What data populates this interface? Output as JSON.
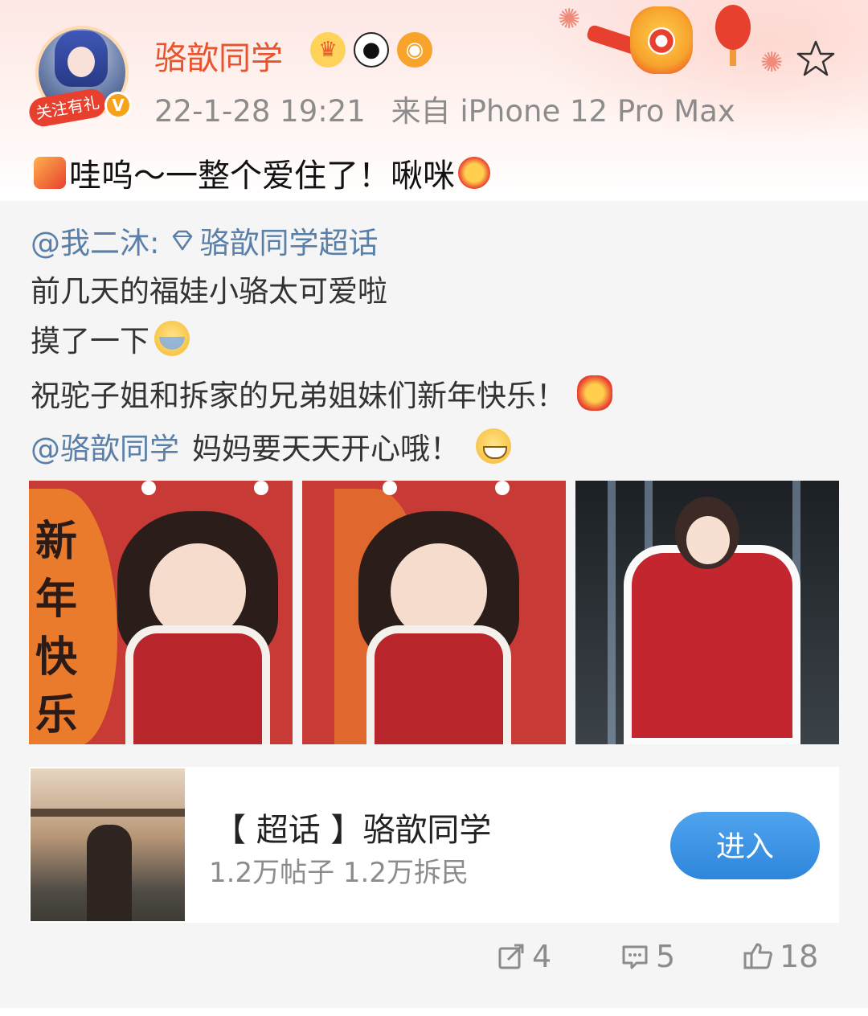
{
  "post": {
    "username": "骆歆同学",
    "avatar_badge": "关注有礼",
    "verified_mark": "V",
    "timestamp": "22-1-28 19:21",
    "source": "来自 iPhone 12 Pro Max",
    "text": "哇呜～一整个爱住了！啾咪"
  },
  "repost": {
    "author": "@我二沐:",
    "topic_link": "骆歆同学超话",
    "lines": [
      "前几天的福娃小骆太可爱啦",
      "摸了一下",
      "祝驼子姐和拆家的兄弟姐妹们新年快乐！"
    ],
    "mention": "@骆歆同学",
    "mention_text": "妈妈要天天开心哦！",
    "image1_text": "新年快乐"
  },
  "topic_card": {
    "title": "【 超话 】骆歆同学",
    "stats": "1.2万帖子 1.2万拆民",
    "button_label": "进入"
  },
  "actions": {
    "repost_count": "4",
    "comment_count": "5",
    "like_count": "18"
  },
  "icons": [
    "star-icon",
    "crown-icon",
    "panda-icon",
    "tiger-icon",
    "diamond-icon",
    "repost-icon",
    "comment-icon",
    "like-icon"
  ],
  "colors": {
    "username": "#e8542e",
    "link": "#5a7fa8",
    "meta": "#8c8c8c",
    "button": "#3b94e4",
    "repost_bg": "#f5f5f5"
  }
}
